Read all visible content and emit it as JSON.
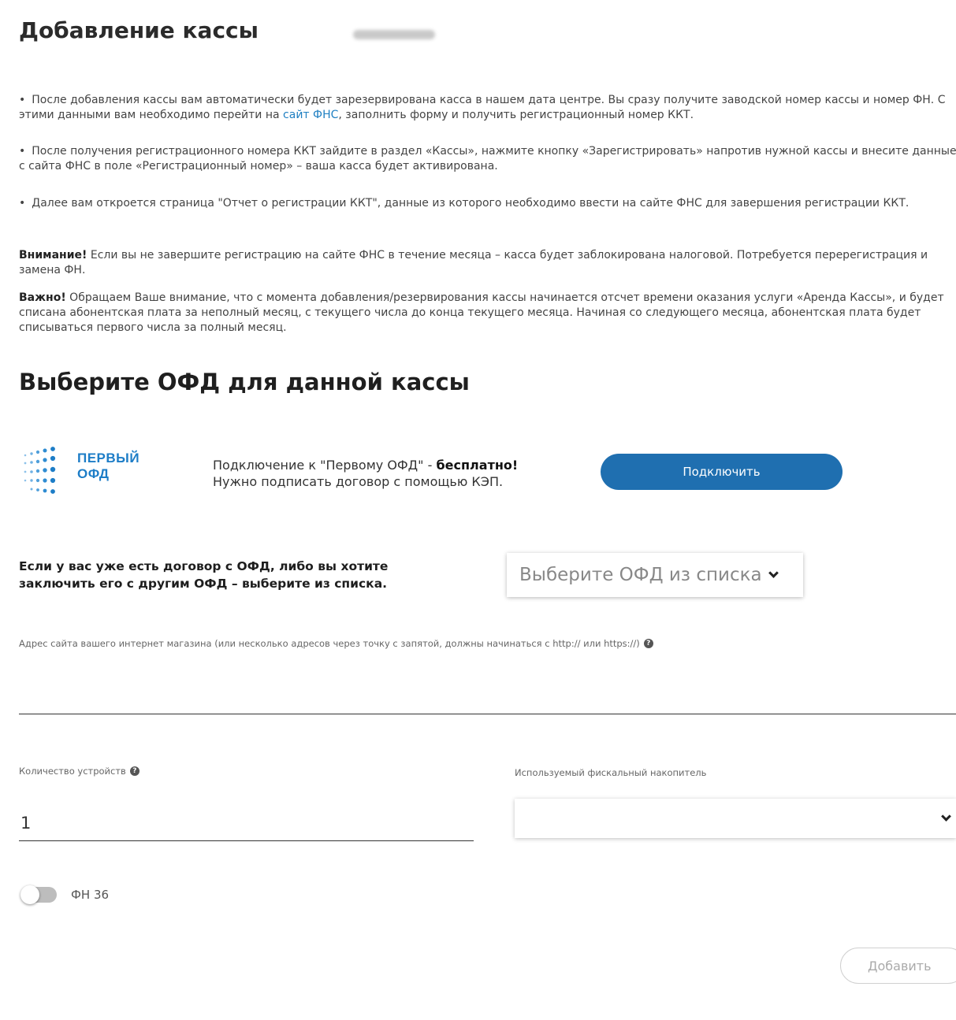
{
  "page": {
    "title": "Добавление кассы"
  },
  "info": {
    "p1_text_before": "После добавления кассы вам автоматически будет зарезервирована касса в нашем дата центре. Вы сразу получите заводской номер кассы и номер ФН. С этими данными вам необходимо перейти на ",
    "p1_link": "сайт ФНС",
    "p1_text_after": ", заполнить форму и получить регистрационный номер ККТ.",
    "p2_text": "После получения регистрационного номера ККТ зайдите в раздел «Кассы», нажмите кнопку «Зарегистрировать» напротив нужной кассы и внесите данные с сайта ФНС в поле «Регистрационный номер» – ваша касса будет активирована.",
    "p3_text": "Далее вам откроется страница \"Отчет о регистрации ККТ\", данные из которого необходимо ввести на сайте ФНС для завершения регистрации ККТ.",
    "warning_label": "Внимание!",
    "warning_text": " Если вы не завершите регистрацию на сайте ФНС в течение месяца – касса будет заблокирована налоговой. Потребуется перерегистрация и замена ФН.",
    "important_label": "Важно!",
    "important_text": " Обращаем Ваше внимание, что с момента добавления/резервирования кассы начинается отсчет времени оказания услуги «Аренда Кассы», и будет списана абонентская плата за неполный месяц, с текущего числа до конца текущего месяца. Начиная со следующего месяца, абонентская плата будет списываться первого числа за полный месяц."
  },
  "ofd": {
    "heading": "Выберите ОФД для данной кассы",
    "logo_line1": "ПЕРВЫЙ",
    "logo_line2": "ОФД",
    "desc_line1_prefix": "Подключение к \"Первому ОФД\" - ",
    "desc_line1_bold": "бесплатно!",
    "desc_line2": "Нужно подписать договор с помощью КЭП.",
    "connect_button": "Подключить",
    "contract_text": "Если у вас уже есть договор с ОФД, либо вы хотите заключить его с другим ОФД – выберите из списка.",
    "select_placeholder": "Выберите ОФД из списка"
  },
  "form": {
    "address_label": "Адрес сайта вашего интернет магазина (или несколько адресов через точку с запятой, должны начинаться с http:// или https://)",
    "address_value": "",
    "devices_label": "Количество устройств",
    "devices_value": "1",
    "fn_label": "Используемый фискальный накопитель",
    "fn_value": "",
    "toggle_label": "ФН 36",
    "toggle_on": false,
    "add_button": "Добавить"
  },
  "colors": {
    "accent": "#1f6fb0",
    "link": "#1e7fc2"
  }
}
